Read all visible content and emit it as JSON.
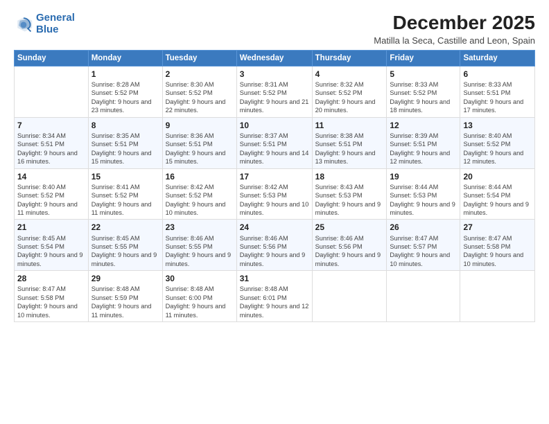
{
  "logo": {
    "line1": "General",
    "line2": "Blue"
  },
  "title": "December 2025",
  "subtitle": "Matilla la Seca, Castille and Leon, Spain",
  "header_days": [
    "Sunday",
    "Monday",
    "Tuesday",
    "Wednesday",
    "Thursday",
    "Friday",
    "Saturday"
  ],
  "weeks": [
    [
      {
        "num": "",
        "sunrise": "",
        "sunset": "",
        "daylight": ""
      },
      {
        "num": "1",
        "sunrise": "Sunrise: 8:28 AM",
        "sunset": "Sunset: 5:52 PM",
        "daylight": "Daylight: 9 hours and 23 minutes."
      },
      {
        "num": "2",
        "sunrise": "Sunrise: 8:30 AM",
        "sunset": "Sunset: 5:52 PM",
        "daylight": "Daylight: 9 hours and 22 minutes."
      },
      {
        "num": "3",
        "sunrise": "Sunrise: 8:31 AM",
        "sunset": "Sunset: 5:52 PM",
        "daylight": "Daylight: 9 hours and 21 minutes."
      },
      {
        "num": "4",
        "sunrise": "Sunrise: 8:32 AM",
        "sunset": "Sunset: 5:52 PM",
        "daylight": "Daylight: 9 hours and 20 minutes."
      },
      {
        "num": "5",
        "sunrise": "Sunrise: 8:33 AM",
        "sunset": "Sunset: 5:52 PM",
        "daylight": "Daylight: 9 hours and 18 minutes."
      },
      {
        "num": "6",
        "sunrise": "Sunrise: 8:33 AM",
        "sunset": "Sunset: 5:51 PM",
        "daylight": "Daylight: 9 hours and 17 minutes."
      }
    ],
    [
      {
        "num": "7",
        "sunrise": "Sunrise: 8:34 AM",
        "sunset": "Sunset: 5:51 PM",
        "daylight": "Daylight: 9 hours and 16 minutes."
      },
      {
        "num": "8",
        "sunrise": "Sunrise: 8:35 AM",
        "sunset": "Sunset: 5:51 PM",
        "daylight": "Daylight: 9 hours and 15 minutes."
      },
      {
        "num": "9",
        "sunrise": "Sunrise: 8:36 AM",
        "sunset": "Sunset: 5:51 PM",
        "daylight": "Daylight: 9 hours and 15 minutes."
      },
      {
        "num": "10",
        "sunrise": "Sunrise: 8:37 AM",
        "sunset": "Sunset: 5:51 PM",
        "daylight": "Daylight: 9 hours and 14 minutes."
      },
      {
        "num": "11",
        "sunrise": "Sunrise: 8:38 AM",
        "sunset": "Sunset: 5:51 PM",
        "daylight": "Daylight: 9 hours and 13 minutes."
      },
      {
        "num": "12",
        "sunrise": "Sunrise: 8:39 AM",
        "sunset": "Sunset: 5:51 PM",
        "daylight": "Daylight: 9 hours and 12 minutes."
      },
      {
        "num": "13",
        "sunrise": "Sunrise: 8:40 AM",
        "sunset": "Sunset: 5:52 PM",
        "daylight": "Daylight: 9 hours and 12 minutes."
      }
    ],
    [
      {
        "num": "14",
        "sunrise": "Sunrise: 8:40 AM",
        "sunset": "Sunset: 5:52 PM",
        "daylight": "Daylight: 9 hours and 11 minutes."
      },
      {
        "num": "15",
        "sunrise": "Sunrise: 8:41 AM",
        "sunset": "Sunset: 5:52 PM",
        "daylight": "Daylight: 9 hours and 11 minutes."
      },
      {
        "num": "16",
        "sunrise": "Sunrise: 8:42 AM",
        "sunset": "Sunset: 5:52 PM",
        "daylight": "Daylight: 9 hours and 10 minutes."
      },
      {
        "num": "17",
        "sunrise": "Sunrise: 8:42 AM",
        "sunset": "Sunset: 5:53 PM",
        "daylight": "Daylight: 9 hours and 10 minutes."
      },
      {
        "num": "18",
        "sunrise": "Sunrise: 8:43 AM",
        "sunset": "Sunset: 5:53 PM",
        "daylight": "Daylight: 9 hours and 9 minutes."
      },
      {
        "num": "19",
        "sunrise": "Sunrise: 8:44 AM",
        "sunset": "Sunset: 5:53 PM",
        "daylight": "Daylight: 9 hours and 9 minutes."
      },
      {
        "num": "20",
        "sunrise": "Sunrise: 8:44 AM",
        "sunset": "Sunset: 5:54 PM",
        "daylight": "Daylight: 9 hours and 9 minutes."
      }
    ],
    [
      {
        "num": "21",
        "sunrise": "Sunrise: 8:45 AM",
        "sunset": "Sunset: 5:54 PM",
        "daylight": "Daylight: 9 hours and 9 minutes."
      },
      {
        "num": "22",
        "sunrise": "Sunrise: 8:45 AM",
        "sunset": "Sunset: 5:55 PM",
        "daylight": "Daylight: 9 hours and 9 minutes."
      },
      {
        "num": "23",
        "sunrise": "Sunrise: 8:46 AM",
        "sunset": "Sunset: 5:55 PM",
        "daylight": "Daylight: 9 hours and 9 minutes."
      },
      {
        "num": "24",
        "sunrise": "Sunrise: 8:46 AM",
        "sunset": "Sunset: 5:56 PM",
        "daylight": "Daylight: 9 hours and 9 minutes."
      },
      {
        "num": "25",
        "sunrise": "Sunrise: 8:46 AM",
        "sunset": "Sunset: 5:56 PM",
        "daylight": "Daylight: 9 hours and 9 minutes."
      },
      {
        "num": "26",
        "sunrise": "Sunrise: 8:47 AM",
        "sunset": "Sunset: 5:57 PM",
        "daylight": "Daylight: 9 hours and 10 minutes."
      },
      {
        "num": "27",
        "sunrise": "Sunrise: 8:47 AM",
        "sunset": "Sunset: 5:58 PM",
        "daylight": "Daylight: 9 hours and 10 minutes."
      }
    ],
    [
      {
        "num": "28",
        "sunrise": "Sunrise: 8:47 AM",
        "sunset": "Sunset: 5:58 PM",
        "daylight": "Daylight: 9 hours and 10 minutes."
      },
      {
        "num": "29",
        "sunrise": "Sunrise: 8:48 AM",
        "sunset": "Sunset: 5:59 PM",
        "daylight": "Daylight: 9 hours and 11 minutes."
      },
      {
        "num": "30",
        "sunrise": "Sunrise: 8:48 AM",
        "sunset": "Sunset: 6:00 PM",
        "daylight": "Daylight: 9 hours and 11 minutes."
      },
      {
        "num": "31",
        "sunrise": "Sunrise: 8:48 AM",
        "sunset": "Sunset: 6:01 PM",
        "daylight": "Daylight: 9 hours and 12 minutes."
      },
      {
        "num": "",
        "sunrise": "",
        "sunset": "",
        "daylight": ""
      },
      {
        "num": "",
        "sunrise": "",
        "sunset": "",
        "daylight": ""
      },
      {
        "num": "",
        "sunrise": "",
        "sunset": "",
        "daylight": ""
      }
    ]
  ]
}
